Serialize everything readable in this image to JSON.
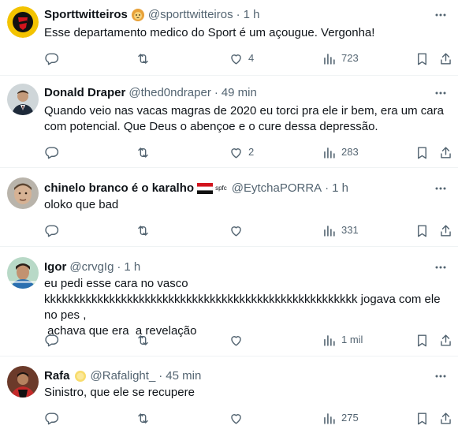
{
  "tweets": [
    {
      "name": "Sporttwitteiros",
      "handle": "@sporttwitteiros",
      "time": "1 h",
      "text": "Esse departamento medico do Sport é um açougue. Vergonha!",
      "replies": "",
      "retweets": "",
      "likes": "4",
      "views": "723"
    },
    {
      "name": "Donald Draper",
      "handle": "@thed0ndraper",
      "time": "49 min",
      "text": "Quando veio nas vacas magras de 2020 eu torci pra ele ir bem, era um cara com potencial. Que Deus o abençoe e o cure dessa depressão.",
      "replies": "",
      "retweets": "",
      "likes": "2",
      "views": "283"
    },
    {
      "name": "chinelo branco é o karalho",
      "name_suffix": "spfc",
      "handle": "@EytchaPORRA",
      "time": "1 h",
      "text": "oloko que bad",
      "replies": "",
      "retweets": "",
      "likes": "",
      "views": "331"
    },
    {
      "name": "Igor",
      "handle": "@crvgIg",
      "time": "1 h",
      "text": "eu pedi esse cara no vasco\nkkkkkkkkkkkkkkkkkkkkkkkkkkkkkkkkkkkkkkkkkkkkkkkkkkkkk jogava com ele no pes ,\n achava que era  a revelação",
      "replies": "",
      "retweets": "",
      "likes": "",
      "views": "1 mil"
    },
    {
      "name": "Rafa",
      "handle": "@Rafalight_",
      "time": "45 min",
      "text": "Sinistro, que ele se recupere",
      "replies": "",
      "retweets": "",
      "likes": "",
      "views": "275"
    }
  ],
  "colors": {
    "text_primary": "#0f1419",
    "text_secondary": "#536471",
    "divider": "#eff3f4"
  },
  "icons": [
    "more-icon",
    "reply-icon",
    "retweet-icon",
    "like-icon",
    "views-icon",
    "bookmark-icon",
    "share-icon",
    "lion-badge-icon",
    "flag-icon",
    "sun-badge-icon"
  ]
}
